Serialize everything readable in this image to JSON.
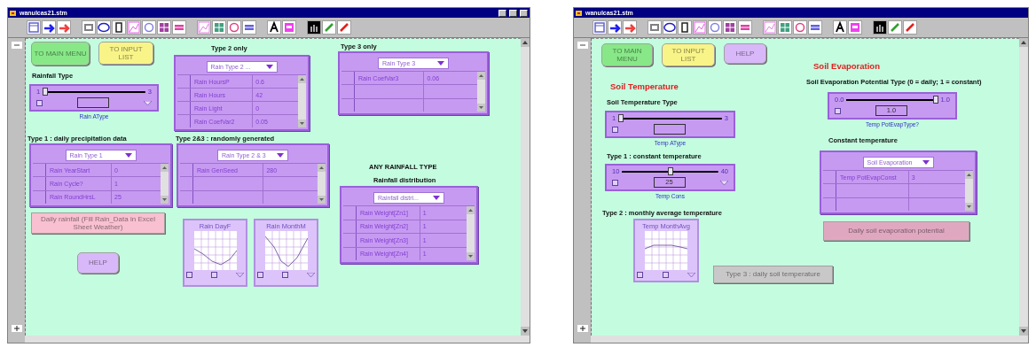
{
  "windows": [
    {
      "title": "wanulcas21.stm",
      "window_buttons": true,
      "widgets": [
        {
          "kind": "button",
          "label": "TO MAIN MENU",
          "color": "#88e888"
        },
        {
          "kind": "button",
          "label": "TO INPUT LIST",
          "color": "#f8f488"
        },
        {
          "kind": "label",
          "text": "Rainfall Type"
        },
        {
          "kind": "slider",
          "min": "1",
          "max": "3",
          "level": 0,
          "caption": "Rain AType",
          "dropdown": true
        },
        {
          "kind": "label",
          "text": "Type 2 only"
        },
        {
          "kind": "table",
          "dropdown": "Rain Type 2 ...",
          "rows": [
            {
              "name": "Rain HoursP",
              "value": "0.6"
            },
            {
              "name": "Rain Hours",
              "value": "42"
            },
            {
              "name": "Rain Light",
              "value": "0"
            },
            {
              "name": "Rain CoefVar2",
              "value": "0.05"
            }
          ]
        },
        {
          "kind": "label",
          "text": "Type 3 only"
        },
        {
          "kind": "table",
          "dropdown": "Rain Type 3",
          "rows": [
            {
              "name": "Rain CoefVar3",
              "value": "0.06"
            }
          ]
        },
        {
          "kind": "label",
          "text": "Type 1 : daily precipitation data"
        },
        {
          "kind": "table",
          "dropdown": "Rain Type 1",
          "rows": [
            {
              "name": "Rain YearStart",
              "value": "0"
            },
            {
              "name": "Rain Cycle?",
              "value": "1"
            },
            {
              "name": "Rain RoundHrsL",
              "value": "25"
            }
          ]
        },
        {
          "kind": "label",
          "text": "Type 2&3 : randomly generated"
        },
        {
          "kind": "table",
          "dropdown": "Rain Type 2 & 3",
          "rows": [
            {
              "name": "Rain GenSeed",
              "value": "280"
            }
          ]
        },
        {
          "kind": "button",
          "label": "Daily rainfall (Fill Rain_Data in Excel Sheet Weather)",
          "color": "#f8c0d0"
        },
        {
          "kind": "button",
          "label": "HELP",
          "color": "#d8b8f8"
        },
        {
          "kind": "graph",
          "caption": "Rain DayF"
        },
        {
          "kind": "graph",
          "caption": "Rain MonthM"
        },
        {
          "kind": "label",
          "text": "ANY RAINFALL TYPE"
        },
        {
          "kind": "label",
          "text": "Rainfall distribution"
        },
        {
          "kind": "table",
          "dropdown": "Rainfall distri...",
          "rows": [
            {
              "name": "Rain Weight[Zn1]",
              "value": "1"
            },
            {
              "name": "Rain Weight[Zn2]",
              "value": "1"
            },
            {
              "name": "Rain Weight[Zn3]",
              "value": "1"
            },
            {
              "name": "Rain Weight[Zn4]",
              "value": "1"
            }
          ]
        }
      ]
    },
    {
      "title": "wanulcas21.stm",
      "window_buttons": false,
      "widgets": [
        {
          "kind": "button",
          "label": "TO MAIN MENU",
          "color": "#88e888"
        },
        {
          "kind": "button",
          "label": "TO INPUT LIST",
          "color": "#f8f488"
        },
        {
          "kind": "button",
          "label": "HELP",
          "color": "#d8b8f8"
        },
        {
          "kind": "heading",
          "text": "Soil Evaporation"
        },
        {
          "kind": "label",
          "text": "Soil Evaporation Potential Type (0 = daily; 1 = constant)"
        },
        {
          "kind": "heading",
          "text": "Soil Temperature"
        },
        {
          "kind": "label",
          "text": "Soil Temperature Type"
        },
        {
          "kind": "slider",
          "min": "1",
          "max": "3",
          "level": 0,
          "caption": "Temp AType",
          "dropdown": false
        },
        {
          "kind": "slider",
          "min": "0.0",
          "max": "1.0",
          "level": 1,
          "value": "1.0",
          "caption": "Temp PotEvapType?",
          "dropdown": false
        },
        {
          "kind": "label",
          "text": "Constant temperature"
        },
        {
          "kind": "table",
          "dropdown": "Soil Evaporation",
          "rows": [
            {
              "name": "Temp PotEvapConst",
              "value": "3"
            }
          ]
        },
        {
          "kind": "label",
          "text": "Type 1 : constant temperature"
        },
        {
          "kind": "slider",
          "min": "10",
          "max": "40",
          "level": 0.5,
          "value": "25",
          "caption": "Temp Cons",
          "dropdown": true
        },
        {
          "kind": "button",
          "label": "Daily soil evaporation potential",
          "color": "#e0a8c0"
        },
        {
          "kind": "label",
          "text": "Type 2 : monthly average temperature"
        },
        {
          "kind": "graph",
          "caption": "Temp MonthAvg"
        },
        {
          "kind": "button",
          "label": "Type 3 : daily soil temperature",
          "color": "#c8c8c8"
        }
      ]
    }
  ]
}
